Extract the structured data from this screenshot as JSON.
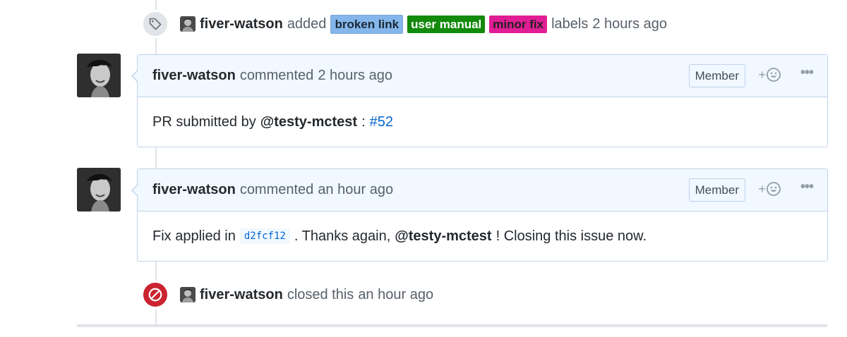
{
  "events": {
    "labeled": {
      "author": "fiver-watson",
      "action": "added",
      "labels": [
        {
          "name": "broken link",
          "color": "#84b6eb"
        },
        {
          "name": "user manual",
          "color": "#128a0c"
        },
        {
          "name": "minor fix",
          "color": "#e11d95"
        }
      ],
      "suffix": "labels",
      "time": "2 hours ago"
    },
    "closed": {
      "author": "fiver-watson",
      "text": "closed this",
      "time": "an hour ago"
    }
  },
  "comments": [
    {
      "author": "fiver-watson",
      "verb": "commented",
      "time": "2 hours ago",
      "role": "Member",
      "body": {
        "prefix": "PR submitted by",
        "mention": "@testy-mctest",
        "separator": ":",
        "link": "#52"
      }
    },
    {
      "author": "fiver-watson",
      "verb": "commented",
      "time": "an hour ago",
      "role": "Member",
      "body": {
        "prefix": "Fix applied in",
        "commit": "d2fcf12",
        "middle": ". Thanks again,",
        "mention": "@testy-mctest",
        "suffix": "! Closing this issue now."
      }
    }
  ],
  "icons": {
    "label_event": "tag-icon",
    "closed_event": "circle-slash-icon",
    "reaction": "smiley-icon",
    "more": "kebab-horizontal-icon"
  },
  "colors": {
    "closed_badge": "#cb2431",
    "header_bg": "#f1f8ff",
    "link": "#0366d6"
  }
}
